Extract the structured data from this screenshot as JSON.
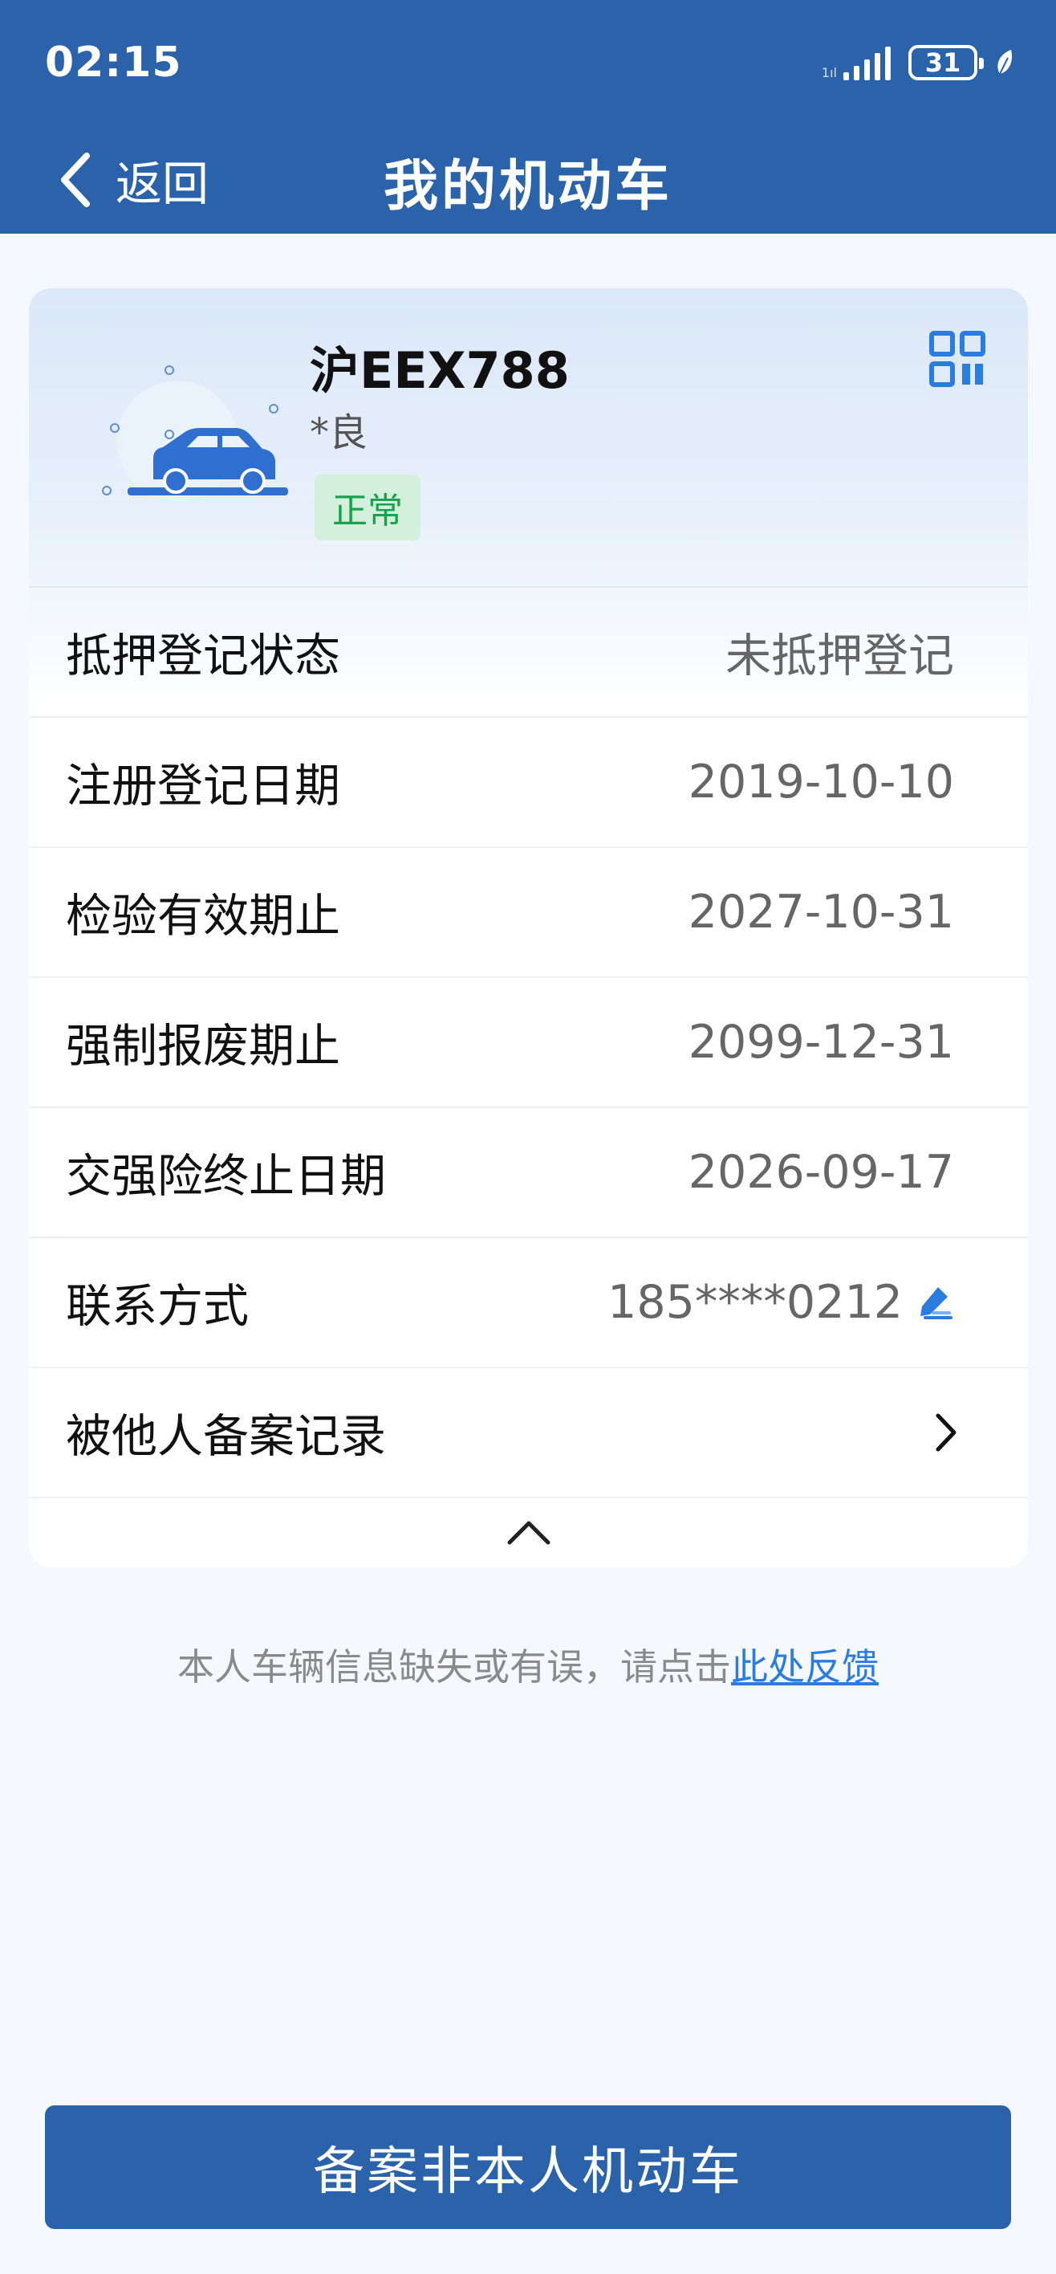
{
  "status_bar": {
    "time": "02:15",
    "signal_tiny": "1ıl",
    "battery": "31"
  },
  "nav": {
    "back_label": "返回",
    "title": "我的机动车"
  },
  "vehicle": {
    "plate": "沪EEX788",
    "owner": "*良",
    "status": "正常",
    "icons": [
      "car-icon",
      "qr-code-icon"
    ]
  },
  "details": [
    {
      "label": "抵押登记状态",
      "value": "未抵押登记"
    },
    {
      "label": "注册登记日期",
      "value": "2019-10-10"
    },
    {
      "label": "检验有效期止",
      "value": "2027-10-31"
    },
    {
      "label": "强制报废期止",
      "value": "2099-12-31"
    },
    {
      "label": "交强险终止日期",
      "value": "2026-09-17"
    },
    {
      "label": "联系方式",
      "value": "185****0212"
    },
    {
      "label": "被他人备案记录",
      "value": ""
    }
  ],
  "feedback": {
    "text": "本人车辆信息缺失或有误，请点击",
    "link": "此处反馈"
  },
  "primary_button": {
    "label": "备案非本人机动车"
  },
  "colors": {
    "header": "#2a63a9",
    "badge_bg": "#d3f0dc",
    "badge_text": "#17a349",
    "link": "#2b7ce0"
  }
}
